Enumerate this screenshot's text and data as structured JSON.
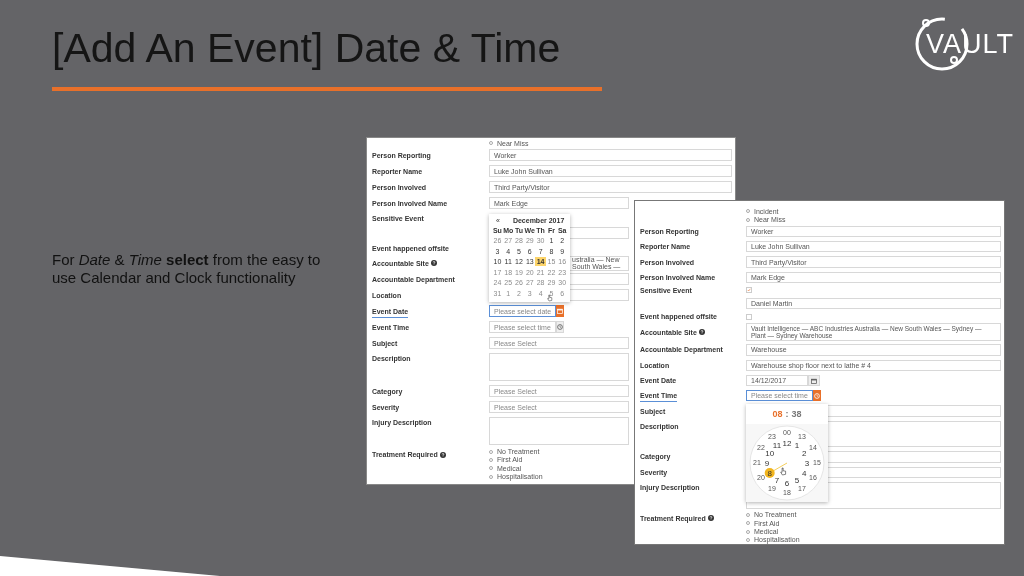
{
  "title": "[Add An Event]  Date & Time",
  "logo": "VAULT",
  "description": "For *Date* & *Time* **select** from the easy to use Calendar and Clock functionality",
  "back": {
    "rows": [
      {
        "kind": "radios",
        "options": [
          {
            "label": "Near Miss",
            "selected": false
          }
        ]
      },
      {
        "kind": "input",
        "label": "Person Reporting",
        "value": "Worker"
      },
      {
        "kind": "input",
        "label": "Reporter Name",
        "value": "Luke  John Sullivan"
      },
      {
        "kind": "input",
        "label": "Person Involved",
        "value": "Third Party/Visitor"
      },
      {
        "kind": "input",
        "label": "Person Involved Name",
        "value": "Mark Edge"
      },
      {
        "kind": "label",
        "label": "Sensitive Event"
      },
      {
        "kind": "input"
      },
      {
        "kind": "label",
        "label": "Event happened offsite"
      },
      {
        "kind": "input_partial",
        "label": "Accountable Site",
        "help": true,
        "value": "ustralia — New South Wales —"
      },
      {
        "kind": "input",
        "label": "Accountable Department"
      },
      {
        "kind": "input",
        "label": "Location"
      },
      {
        "kind": "date",
        "label": "Event Date",
        "placeholder": "Please select date",
        "active": true
      },
      {
        "kind": "time",
        "label": "Event Time",
        "placeholder": "Please select time",
        "active": false
      },
      {
        "kind": "input",
        "label": "Subject",
        "placeholder": "Please Select"
      },
      {
        "kind": "textarea",
        "label": "Description"
      },
      {
        "kind": "input",
        "label": "Category",
        "placeholder": "Please Select"
      },
      {
        "kind": "input",
        "label": "Severity",
        "placeholder": "Please Select"
      },
      {
        "kind": "textarea",
        "label": "Injury Description"
      },
      {
        "kind": "radios",
        "label": "Treatment Required",
        "help": true,
        "options": [
          {
            "label": "No Treatment",
            "selected": false
          },
          {
            "label": "First Aid",
            "selected": false
          },
          {
            "label": "Medical",
            "selected": false
          },
          {
            "label": "Hospitalisation",
            "selected": false
          }
        ]
      }
    ],
    "datepicker": {
      "prev": "«",
      "month": "December 2017",
      "weekdays": [
        "Su",
        "Mo",
        "Tu",
        "We",
        "Th",
        "Fr",
        "Sa"
      ],
      "days": [
        {
          "label": "26",
          "muted": true,
          "selected": false
        },
        {
          "label": "27",
          "muted": true,
          "selected": false
        },
        {
          "label": "28",
          "muted": true,
          "selected": false
        },
        {
          "label": "29",
          "muted": true,
          "selected": false
        },
        {
          "label": "30",
          "muted": true,
          "selected": false
        },
        {
          "label": "1",
          "muted": false,
          "selected": false
        },
        {
          "label": "2",
          "muted": false,
          "selected": false
        },
        {
          "label": "3",
          "muted": false,
          "selected": false
        },
        {
          "label": "4",
          "muted": false,
          "selected": false
        },
        {
          "label": "5",
          "muted": false,
          "selected": false
        },
        {
          "label": "6",
          "muted": false,
          "selected": false
        },
        {
          "label": "7",
          "muted": false,
          "selected": false
        },
        {
          "label": "8",
          "muted": false,
          "selected": false
        },
        {
          "label": "9",
          "muted": false,
          "selected": false
        },
        {
          "label": "10",
          "muted": false,
          "selected": false
        },
        {
          "label": "11",
          "muted": false,
          "selected": false
        },
        {
          "label": "12",
          "muted": false,
          "selected": false
        },
        {
          "label": "13",
          "muted": false,
          "selected": false
        },
        {
          "label": "14",
          "muted": false,
          "selected": true
        },
        {
          "label": "15",
          "muted": true,
          "selected": false
        },
        {
          "label": "16",
          "muted": true,
          "selected": false
        },
        {
          "label": "17",
          "muted": true,
          "selected": false
        },
        {
          "label": "18",
          "muted": true,
          "selected": false
        },
        {
          "label": "19",
          "muted": true,
          "selected": false
        },
        {
          "label": "20",
          "muted": true,
          "selected": false
        },
        {
          "label": "21",
          "muted": true,
          "selected": false
        },
        {
          "label": "22",
          "muted": true,
          "selected": false
        },
        {
          "label": "23",
          "muted": true,
          "selected": false
        },
        {
          "label": "24",
          "muted": true,
          "selected": false
        },
        {
          "label": "25",
          "muted": true,
          "selected": false
        },
        {
          "label": "26",
          "muted": true,
          "selected": false
        },
        {
          "label": "27",
          "muted": true,
          "selected": false
        },
        {
          "label": "28",
          "muted": true,
          "selected": false
        },
        {
          "label": "29",
          "muted": true,
          "selected": false
        },
        {
          "label": "30",
          "muted": true,
          "selected": false
        },
        {
          "label": "31",
          "muted": true,
          "selected": false
        },
        {
          "label": "1",
          "muted": true,
          "selected": false
        },
        {
          "label": "2",
          "muted": true,
          "selected": false
        },
        {
          "label": "3",
          "muted": true,
          "selected": false
        },
        {
          "label": "4",
          "muted": true,
          "selected": false
        },
        {
          "label": "5",
          "muted": true,
          "selected": false
        },
        {
          "label": "6",
          "muted": true,
          "selected": false
        }
      ]
    }
  },
  "front": {
    "rows": [
      {
        "kind": "radios",
        "options": [
          {
            "label": "Incident",
            "selected": false
          },
          {
            "label": "Near Miss",
            "selected": false
          }
        ]
      },
      {
        "kind": "input",
        "label": "Person Reporting",
        "value": "Worker"
      },
      {
        "kind": "input",
        "label": "Reporter Name",
        "value": "Luke  John Sullivan"
      },
      {
        "kind": "input",
        "label": "Person Involved",
        "value": "Third Party/Visitor"
      },
      {
        "kind": "input",
        "label": "Person Involved Name",
        "value": "Mark Edge"
      },
      {
        "kind": "checkbox",
        "label": "Sensitive Event",
        "checked": true
      },
      {
        "kind": "input",
        "value": "Daniel Martin"
      },
      {
        "kind": "checkbox",
        "label": "Event happened offsite",
        "checked": false
      },
      {
        "kind": "input",
        "label": "Accountable Site",
        "help": true,
        "value": "Vault Intelligence — ABC Industries Australia — New South Wales — Sydney — Plant — Sydney Warehouse"
      },
      {
        "kind": "input",
        "label": "Accountable Department",
        "value": "Warehouse"
      },
      {
        "kind": "input",
        "label": "Location",
        "value": "Warehouse shop floor next to lathe # 4"
      },
      {
        "kind": "date",
        "label": "Event Date",
        "value": "14/12/2017",
        "active": false
      },
      {
        "kind": "time",
        "label": "Event Time",
        "placeholder": "Please select time",
        "active": true
      },
      {
        "kind": "input",
        "label": "Subject"
      },
      {
        "kind": "textarea",
        "label": "Description"
      },
      {
        "kind": "input",
        "label": "Category"
      },
      {
        "kind": "input",
        "label": "Severity"
      },
      {
        "kind": "textarea",
        "label": "Injury Description"
      },
      {
        "kind": "radios",
        "label": "Treatment Required",
        "help": true,
        "options": [
          {
            "label": "No Treatment",
            "selected": false
          },
          {
            "label": "First Aid",
            "selected": false
          },
          {
            "label": "Medical",
            "selected": false
          },
          {
            "label": "Hospitalisation",
            "selected": false
          }
        ]
      }
    ],
    "clock": {
      "hour": "08",
      "separator": ":",
      "minute": "38",
      "outer_right": [
        {
          "label": "00",
          "selected": false
        },
        {
          "label": "13",
          "selected": false
        },
        {
          "label": "14",
          "selected": false
        },
        {
          "label": "15",
          "selected": false
        },
        {
          "label": "16",
          "selected": false
        },
        {
          "label": "17",
          "selected": false
        },
        {
          "label": "18",
          "selected": false
        }
      ],
      "outer_left": [
        {
          "label": "23",
          "selected": false
        },
        {
          "label": "22",
          "selected": false
        },
        {
          "label": "21",
          "selected": false
        },
        {
          "label": "20",
          "selected": false
        },
        {
          "label": "19",
          "selected": false
        }
      ],
      "inner_right": [
        {
          "label": "12",
          "selected": false
        },
        {
          "label": "1",
          "selected": false
        },
        {
          "label": "2",
          "selected": false
        },
        {
          "label": "3",
          "selected": false
        },
        {
          "label": "4",
          "selected": false
        },
        {
          "label": "5",
          "selected": false
        },
        {
          "label": "6",
          "selected": false
        }
      ],
      "inner_left": [
        {
          "label": "11",
          "selected": false
        },
        {
          "label": "10",
          "selected": false
        },
        {
          "label": "9",
          "selected": false
        },
        {
          "label": "8",
          "selected": true
        },
        {
          "label": "7",
          "selected": false
        }
      ]
    }
  }
}
